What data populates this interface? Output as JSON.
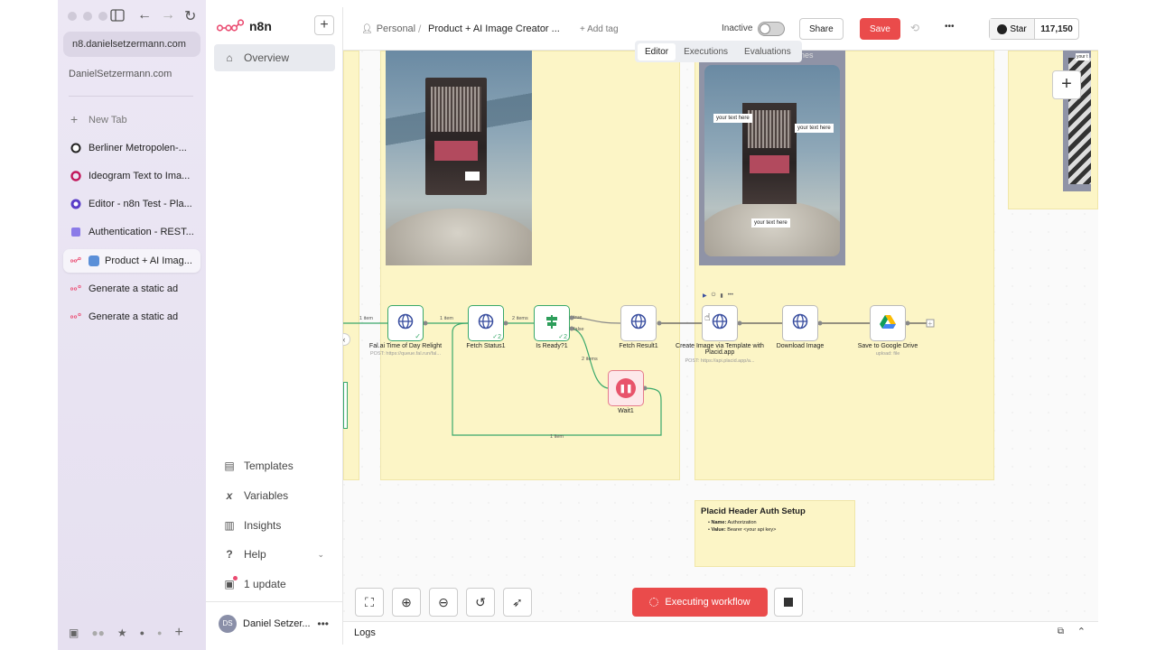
{
  "browser": {
    "url": "n8.danielsetzermann.com",
    "host_label": "DanielSetzermann.com",
    "new_tab_label": "New Tab",
    "tabs": [
      {
        "label": "Berliner Metropolen-...",
        "icon": "berliner-favicon"
      },
      {
        "label": "Ideogram Text to Ima...",
        "icon": "ideogram-favicon"
      },
      {
        "label": "Editor - n8n Test - Pla...",
        "icon": "placid-favicon"
      },
      {
        "label": "Authentication - REST...",
        "icon": "docs-favicon"
      },
      {
        "label": "Product + AI Imag...",
        "icon": "n8n-favicon",
        "active": true
      },
      {
        "label": "Generate a static ad",
        "icon": "n8n-favicon"
      },
      {
        "label": "Generate a static ad",
        "icon": "n8n-favicon"
      }
    ]
  },
  "app": {
    "brand": "n8n",
    "nav": {
      "overview": "Overview",
      "templates": "Templates",
      "variables": "Variables",
      "insights": "Insights",
      "help": "Help",
      "update": "1 update"
    },
    "user": {
      "initials": "DS",
      "name": "Daniel Setzer..."
    }
  },
  "topbar": {
    "project": "Personal",
    "separator": "/",
    "workflow_name": "Product + AI Image Creator ...",
    "add_tag": "+ Add tag",
    "status": "Inactive",
    "share": "Share",
    "save": "Save",
    "star": "Star",
    "star_count": "117,150",
    "tabs": [
      "Editor",
      "Executions",
      "Evaluations"
    ],
    "active_tab": "Editor"
  },
  "canvas": {
    "image_text_labels": [
      "your text here",
      "your text here",
      "your text here"
    ],
    "partial_sticky_text": "nes",
    "right_partial_text": "your t",
    "nodes": [
      {
        "label": "Fal.ai Time of Day Relight",
        "sub": "POST: https://queue.fal.run/fal...",
        "status": "success"
      },
      {
        "label": "Fetch Status1",
        "sub": "",
        "status": "success",
        "count": "2"
      },
      {
        "label": "Is Ready?1",
        "sub": "",
        "status": "success",
        "count": "2"
      },
      {
        "label": "Fetch Result1",
        "sub": "",
        "status": "none"
      },
      {
        "label": "Create Image via Template with Placid.app",
        "sub": "POST: https://api.placid.app/a...",
        "status": "running"
      },
      {
        "label": "Download Image",
        "sub": "",
        "status": "none"
      },
      {
        "label": "Save to Google Drive",
        "sub": "upload: file",
        "status": "none"
      },
      {
        "label": "Wait1",
        "sub": "",
        "status": "waiting"
      }
    ],
    "edge_labels": [
      "1 item",
      "1 item",
      "2 items",
      "true",
      "false",
      "2 items",
      "1 item"
    ],
    "sticky_note": {
      "title": "Placid Header Auth Setup",
      "items": [
        {
          "key": "Name:",
          "value": "Authorization"
        },
        {
          "key": "Value:",
          "value": "Bearer <your api key>"
        }
      ]
    },
    "executing_label": "Executing workflow"
  },
  "logs": {
    "label": "Logs"
  }
}
